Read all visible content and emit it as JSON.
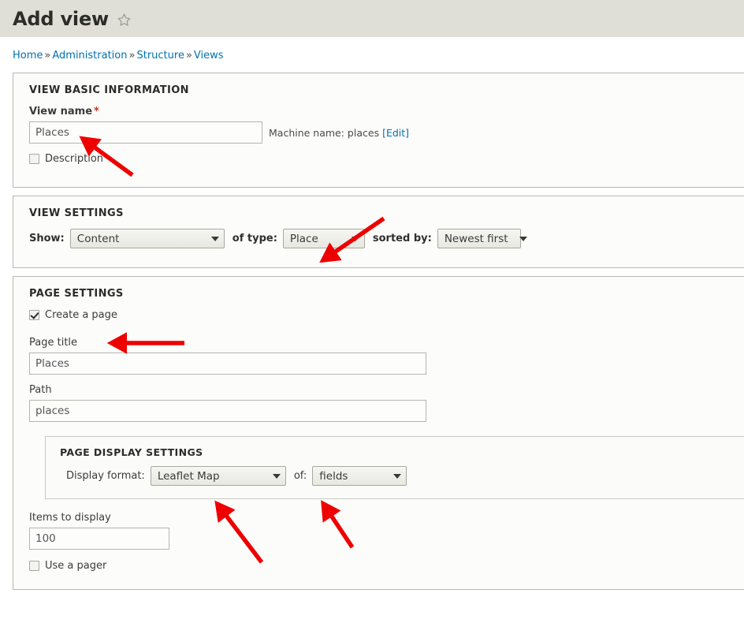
{
  "header": {
    "title": "Add view",
    "star_icon": "star-outline-icon"
  },
  "breadcrumb": {
    "separator": "»",
    "items": [
      "Home",
      "Administration",
      "Structure",
      "Views"
    ]
  },
  "view_basic_information": {
    "legend": "VIEW BASIC INFORMATION",
    "view_name_label": "View name",
    "required_marker": "*",
    "view_name_value": "Places",
    "machine_name_note": "Machine name: places",
    "machine_name_edit": "[Edit]",
    "description_label": "Description",
    "description_checked": false
  },
  "view_settings": {
    "legend": "VIEW SETTINGS",
    "show_label": "Show:",
    "show_value": "Content",
    "of_type_label": "of type:",
    "of_type_value": "Place",
    "sorted_by_label": "sorted by:",
    "sorted_by_value": "Newest first"
  },
  "page_settings": {
    "legend": "PAGE SETTINGS",
    "create_page_label": "Create a page",
    "create_page_checked": true,
    "page_title_label": "Page title",
    "page_title_value": "Places",
    "path_label": "Path",
    "path_value": "places",
    "display_settings": {
      "legend": "PAGE DISPLAY SETTINGS",
      "display_format_label": "Display format:",
      "display_format_value": "Leaflet Map",
      "of_label": "of:",
      "of_value": "fields"
    },
    "items_to_display_label": "Items to display",
    "items_to_display_value": "100",
    "use_pager_label": "Use a pager",
    "use_pager_checked": false
  },
  "colors": {
    "header_bar": "#dfdfd8",
    "link": "#0071b3",
    "annotation_arrow": "#ee0000",
    "required": "#c0392b",
    "fieldset_border": "#b8b8b0"
  },
  "annotations": {
    "arrow_count": 5,
    "targets": [
      "view-name-input",
      "of-type-select",
      "create-page-checkbox",
      "display-format-select",
      "of-fields-select"
    ]
  }
}
